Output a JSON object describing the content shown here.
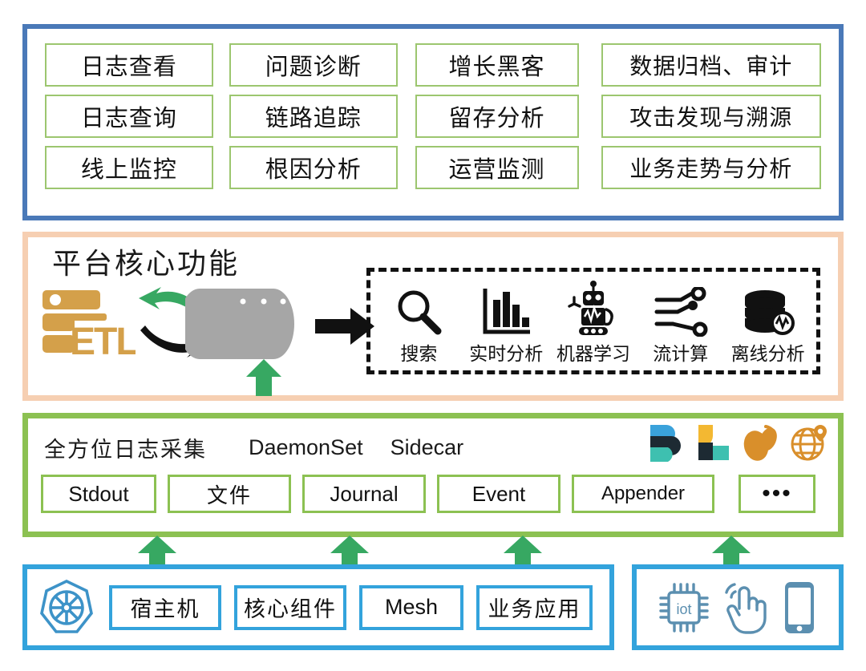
{
  "colors": {
    "scenario_border": "#4a79b8",
    "scenario_box_border": "#9cc66f",
    "core_border": "#f6cfb2",
    "collect_border": "#8cc152",
    "infra_border": "#33a3dc",
    "arrow_green": "#37a862",
    "arrow_black": "#111111",
    "cylinder_gray": "#a6a6a6",
    "etl_orange": "#d6a martin"
  },
  "scenarios": {
    "columns": [
      {
        "items": [
          "日志查看",
          "日志查询",
          "线上监控"
        ]
      },
      {
        "items": [
          "问题诊断",
          "链路追踪",
          "根因分析"
        ]
      },
      {
        "items": [
          "增长黑客",
          "留存分析",
          "运营监测"
        ]
      },
      {
        "items": [
          "数据归档、审计",
          "攻击发现与溯源",
          "业务走势与分析"
        ]
      }
    ]
  },
  "core": {
    "title": "平台核心功能",
    "etl_label": "ETL",
    "capabilities": [
      {
        "icon": "search-icon",
        "label": "搜索"
      },
      {
        "icon": "bar-chart-icon",
        "label": "实时分析"
      },
      {
        "icon": "robot-icon",
        "label": "机器学习"
      },
      {
        "icon": "stream-flow-icon",
        "label": "流计算"
      },
      {
        "icon": "database-analytics-icon",
        "label": "离线分析"
      }
    ]
  },
  "collect": {
    "heading_cn": "全方位日志采集",
    "modes": [
      "DaemonSet",
      "Sidecar"
    ],
    "logos": [
      "beats-logo",
      "logstash-logo",
      "fluentd-logo",
      "globe-pin-logo"
    ],
    "sources": [
      "Stdout",
      "文件",
      "Journal",
      "Event",
      "Appender",
      "•••"
    ]
  },
  "infra": {
    "logo": "kubernetes-logo",
    "items": [
      "宿主机",
      "核心组件",
      "Mesh",
      "业务应用"
    ]
  },
  "devices": {
    "items": [
      "iot-chip-icon",
      "touch-hand-icon",
      "mobile-phone-icon"
    ],
    "iot_label": "iot"
  }
}
